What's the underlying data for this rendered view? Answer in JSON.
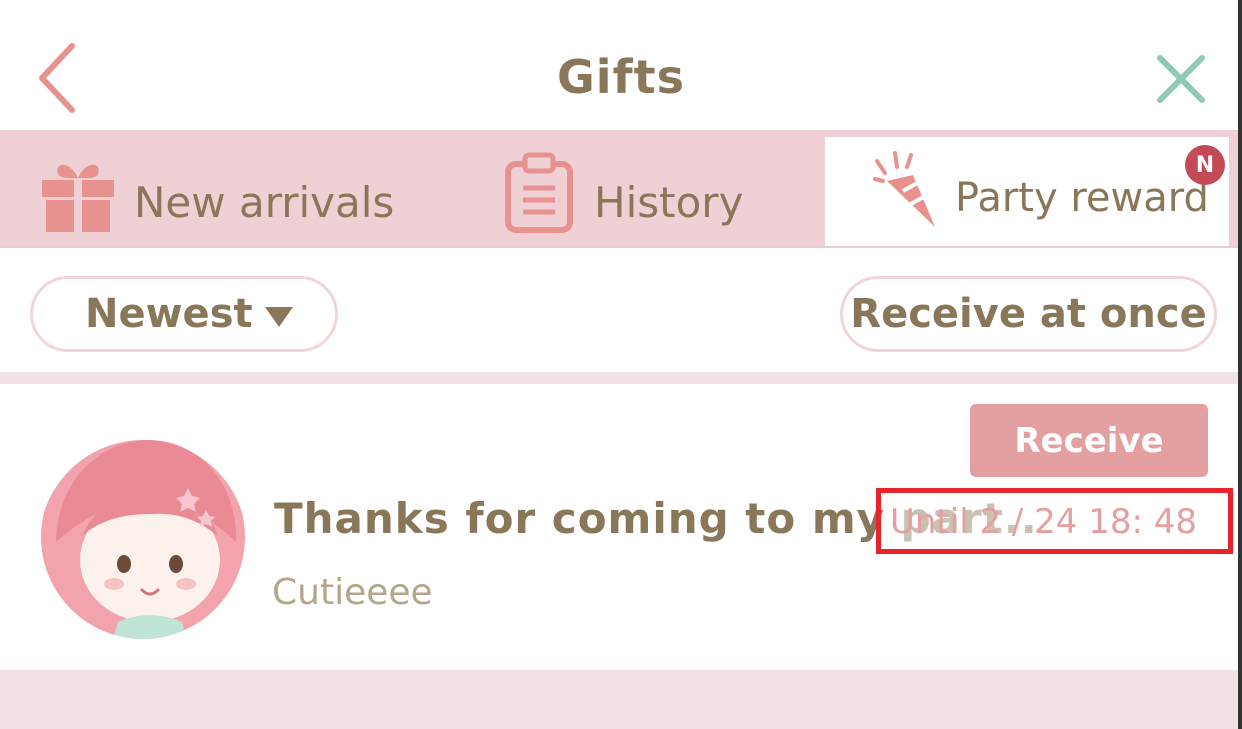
{
  "header": {
    "title": "Gifts",
    "back_icon": "chevron-left-icon",
    "close_icon": "close-icon"
  },
  "tabs": [
    {
      "label": "New arrivals",
      "icon": "gift-icon",
      "active": false
    },
    {
      "label": "History",
      "icon": "clipboard-icon",
      "active": false
    },
    {
      "label": "Party reward",
      "icon": "party-popper-icon",
      "active": true,
      "badge": "N"
    }
  ],
  "filters": {
    "sort_label": "Newest",
    "receive_all_label": "Receive at once"
  },
  "gifts": [
    {
      "title": "Thanks for coming to my part..",
      "sender": "Cutieeee",
      "deadline": "Until 2 / 24 18: 48",
      "receive_label": "Receive"
    }
  ],
  "colors": {
    "accent_pink": "#e49fa1",
    "tab_bar": "#efd0d4",
    "text_brown": "#8a7658",
    "close_green": "#8fcab3",
    "highlight_red": "#e8242b"
  }
}
